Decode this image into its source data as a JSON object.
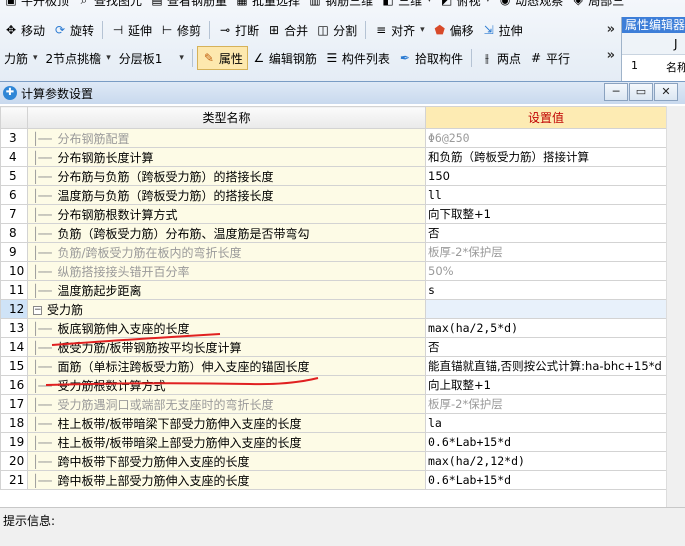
{
  "ribbon": {
    "row0": [
      "牛开极顶",
      "查找图元",
      "查看钢筋量",
      "批量选择",
      "钢筋三维",
      "三维",
      "俯视",
      "动态观察",
      "局部三"
    ],
    "row1": [
      {
        "icon": "move-icon",
        "label": "移动"
      },
      {
        "icon": "rotate-icon",
        "label": "旋转"
      },
      {
        "icon": "extend-icon",
        "label": "延伸"
      },
      {
        "icon": "trim-icon",
        "label": "修剪"
      },
      {
        "icon": "break-icon",
        "label": "打断"
      },
      {
        "icon": "merge-icon",
        "label": "合并"
      },
      {
        "icon": "split-icon",
        "label": "分割"
      },
      {
        "icon": "align-icon",
        "label": "对齐"
      },
      {
        "icon": "offset-icon",
        "label": "偏移"
      },
      {
        "icon": "stretch-icon",
        "label": "拉伸"
      }
    ],
    "row2": {
      "drop1": "力筋",
      "drop2": "2节点挑檐",
      "drop3": "分层板1",
      "btn_attr": "属性",
      "btn_edit": "编辑钢筋",
      "btn_list": "构件列表",
      "btn_pick": "拾取构件",
      "btn_two": "两点",
      "btn_parallel": "平行"
    },
    "chevron": "»"
  },
  "property_panel": {
    "title": "属性编辑器",
    "header": "J",
    "row_num": "1",
    "row_text": "名称"
  },
  "dialog": {
    "title": "计算参数设置",
    "col_name": "类型名称",
    "col_value": "设置值",
    "rows": [
      {
        "num": "3",
        "name": "分布钢筋配置",
        "value": "Φ6@250",
        "dim": true,
        "mono": true
      },
      {
        "num": "4",
        "name": "分布钢筋长度计算",
        "value": "和负筋（跨板受力筋）搭接计算"
      },
      {
        "num": "5",
        "name": "分布筋与负筋（跨板受力筋）的搭接长度",
        "value": "150"
      },
      {
        "num": "6",
        "name": "温度筋与负筋（跨板受力筋）的搭接长度",
        "value": "ll",
        "mono": true
      },
      {
        "num": "7",
        "name": "分布钢筋根数计算方式",
        "value": "向下取整+1"
      },
      {
        "num": "8",
        "name": "负筋（跨板受力筋）分布筋、温度筋是否带弯勾",
        "value": "否"
      },
      {
        "num": "9",
        "name": "负筋/跨板受力筋在板内的弯折长度",
        "value": "板厚-2*保护层",
        "dim": true
      },
      {
        "num": "10",
        "name": "纵筋搭接接头错开百分率",
        "value": "50%",
        "dim": true
      },
      {
        "num": "11",
        "name": "温度筋起步距离",
        "value": "s",
        "mono": true
      },
      {
        "num": "12",
        "name": "受力筋",
        "value": "",
        "group": true
      },
      {
        "num": "13",
        "name": "板底钢筋伸入支座的长度",
        "value": "max(ha/2,5*d)",
        "mono": true
      },
      {
        "num": "14",
        "name": "板受力筋/板带钢筋按平均长度计算",
        "value": "否"
      },
      {
        "num": "15",
        "name": "面筋（单标注跨板受力筋）伸入支座的锚固长度",
        "value": "能直锚就直锚,否则按公式计算:ha-bhc+15*d",
        "mono_mixed": true
      },
      {
        "num": "16",
        "name": "受力筋根数计算方式",
        "value": "向上取整+1"
      },
      {
        "num": "17",
        "name": "受力筋遇洞口或端部无支座时的弯折长度",
        "value": "板厚-2*保护层",
        "dim": true
      },
      {
        "num": "18",
        "name": "柱上板带/板带暗梁下部受力筋伸入支座的长度",
        "value": "la",
        "mono": true
      },
      {
        "num": "19",
        "name": "柱上板带/板带暗梁上部受力筋伸入支座的长度",
        "value": "0.6*Lab+15*d",
        "mono": true
      },
      {
        "num": "20",
        "name": "跨中板带下部受力筋伸入支座的长度",
        "value": "max(ha/2,12*d)",
        "mono": true
      },
      {
        "num": "21",
        "name": "跨中板带上部受力筋伸入支座的长度",
        "value": "0.6*Lab+15*d",
        "mono": true
      }
    ],
    "status_label": "提示信息:"
  },
  "annotation_color": "#e02020"
}
